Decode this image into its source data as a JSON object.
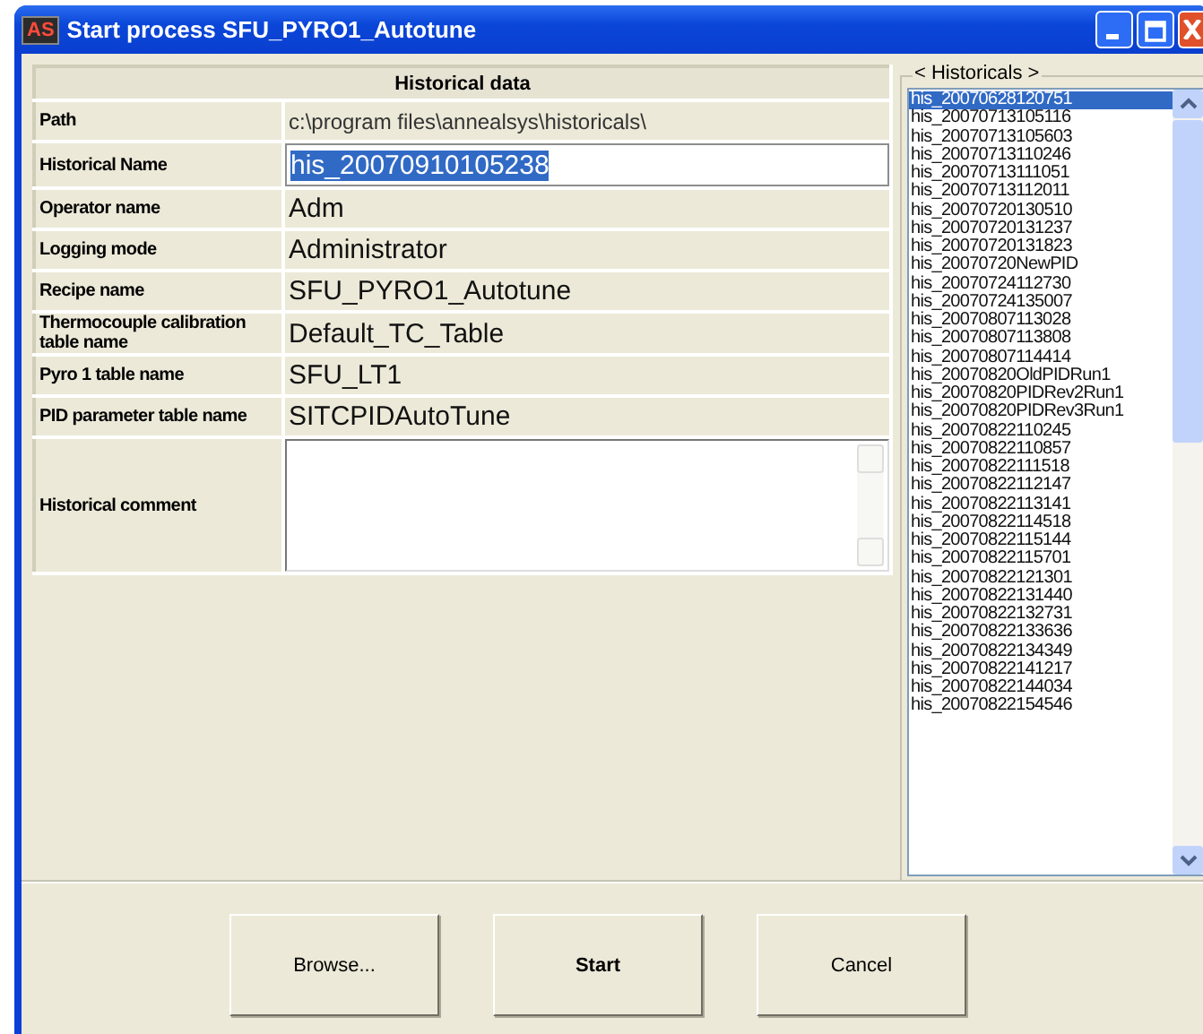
{
  "window": {
    "title": "Start process SFU_PYRO1_Autotune",
    "app_badge": "AS"
  },
  "historical_data": {
    "header": "Historical data",
    "rows": [
      {
        "kind": "path",
        "label": "Path",
        "value": "c:\\program files\\annealsys\\historicals\\"
      },
      {
        "kind": "input",
        "label": "Historical Name",
        "value": "his_20070910105238",
        "text_selected": true
      },
      {
        "kind": "text",
        "label": "Operator name",
        "value": "Adm"
      },
      {
        "kind": "text",
        "label": "Logging mode",
        "value": "Administrator"
      },
      {
        "kind": "text",
        "label": "Recipe name",
        "value": "SFU_PYRO1_Autotune"
      },
      {
        "kind": "text",
        "label": "Thermocouple calibration table name",
        "value": "Default_TC_Table"
      },
      {
        "kind": "text",
        "label": "Pyro 1 table name",
        "value": "SFU_LT1"
      },
      {
        "kind": "text",
        "label": "PID parameter table name",
        "value": "SITCPIDAutoTune"
      },
      {
        "kind": "textarea",
        "label": "Historical comment"
      }
    ]
  },
  "historicals": {
    "label": "< Historicals >",
    "items": [
      {
        "text": "his_20070628120751",
        "selected": true
      },
      {
        "text": "his_20070713105116",
        "selected": false
      },
      {
        "text": "his_20070713105603",
        "selected": false
      },
      {
        "text": "his_20070713110246",
        "selected": false
      },
      {
        "text": "his_20070713111051",
        "selected": false
      },
      {
        "text": "his_20070713112011",
        "selected": false
      },
      {
        "text": "his_20070720130510",
        "selected": false
      },
      {
        "text": "his_20070720131237",
        "selected": false
      },
      {
        "text": "his_20070720131823",
        "selected": false
      },
      {
        "text": "his_20070720NewPID",
        "selected": false
      },
      {
        "text": "his_20070724112730",
        "selected": false
      },
      {
        "text": "his_20070724135007",
        "selected": false
      },
      {
        "text": "his_20070807113028",
        "selected": false
      },
      {
        "text": "his_20070807113808",
        "selected": false
      },
      {
        "text": "his_20070807114414",
        "selected": false
      },
      {
        "text": "his_20070820OldPIDRun1",
        "selected": false
      },
      {
        "text": "his_20070820PIDRev2Run1",
        "selected": false
      },
      {
        "text": "his_20070820PIDRev3Run1",
        "selected": false
      },
      {
        "text": "his_20070822110245",
        "selected": false
      },
      {
        "text": "his_20070822110857",
        "selected": false
      },
      {
        "text": "his_20070822111518",
        "selected": false
      },
      {
        "text": "his_20070822112147",
        "selected": false
      },
      {
        "text": "his_20070822113141",
        "selected": false
      },
      {
        "text": "his_20070822114518",
        "selected": false
      },
      {
        "text": "his_20070822115144",
        "selected": false
      },
      {
        "text": "his_20070822115701",
        "selected": false
      },
      {
        "text": "his_20070822121301",
        "selected": false
      },
      {
        "text": "his_20070822131440",
        "selected": false
      },
      {
        "text": "his_20070822132731",
        "selected": false
      },
      {
        "text": "his_20070822133636",
        "selected": false
      },
      {
        "text": "his_20070822134349",
        "selected": false
      },
      {
        "text": "his_20070822141217",
        "selected": false
      },
      {
        "text": "his_20070822144034",
        "selected": false
      },
      {
        "text": "his_20070822154546",
        "selected": false
      }
    ]
  },
  "buttons": [
    {
      "label": "Browse...",
      "default": false
    },
    {
      "label": "Start",
      "default": true
    },
    {
      "label": "Cancel",
      "default": false
    }
  ]
}
